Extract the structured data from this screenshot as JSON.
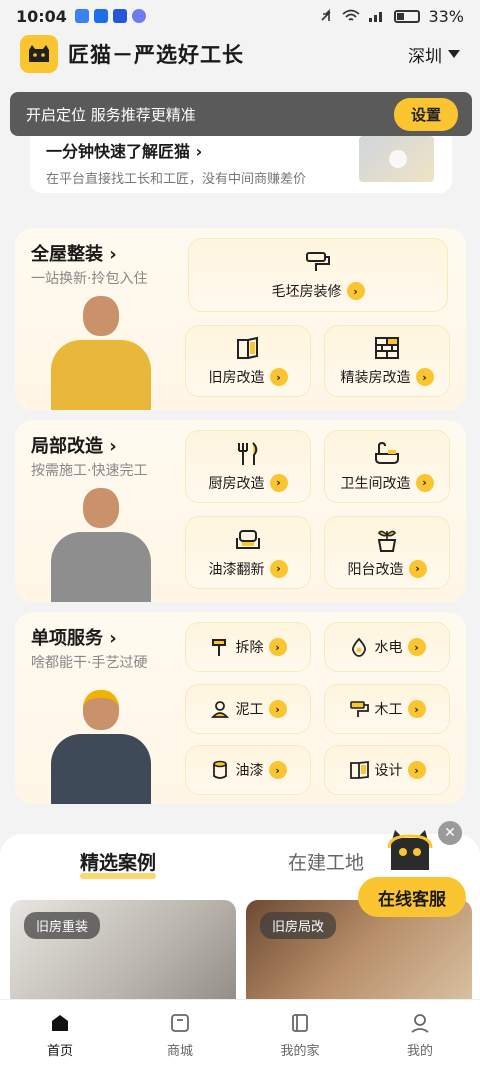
{
  "status_bar": {
    "time": "10:04",
    "battery": "33%"
  },
  "header": {
    "brand": "匠猫－严选好工长",
    "city": "深圳"
  },
  "toast": {
    "text": "开启定位 服务推荐更精准",
    "button": "设置"
  },
  "intro": {
    "title": "一分钟快速了解匠猫 ›",
    "subtitle": "在平台直接找工长和工匠，没有中间商赚差价"
  },
  "sections": [
    {
      "title": "全屋整装",
      "subtitle": "一站换新·拎包入住",
      "tiles": [
        "毛坯房装修",
        "旧房改造",
        "精装房改造"
      ]
    },
    {
      "title": "局部改造",
      "subtitle": "按需施工·快速完工",
      "tiles": [
        "厨房改造",
        "卫生间改造",
        "油漆翻新",
        "阳台改造"
      ]
    },
    {
      "title": "单项服务",
      "subtitle": "啥都能干·手艺过硬",
      "tiles": [
        "拆除",
        "水电",
        "泥工",
        "木工",
        "油漆",
        "设计"
      ]
    }
  ],
  "tabs": {
    "active": "精选案例",
    "inactive": "在建工地"
  },
  "cases": [
    {
      "tag": "旧房重装"
    },
    {
      "tag": "旧房局改"
    }
  ],
  "customer_service": "在线客服",
  "bottom_nav": [
    {
      "label": "首页",
      "icon": "home-icon"
    },
    {
      "label": "商城",
      "icon": "shop-icon"
    },
    {
      "label": "我的家",
      "icon": "house-doc-icon"
    },
    {
      "label": "我的",
      "icon": "profile-icon"
    }
  ],
  "colors": {
    "accent": "#fbc531",
    "toast_bg": "#5a5a5a"
  }
}
